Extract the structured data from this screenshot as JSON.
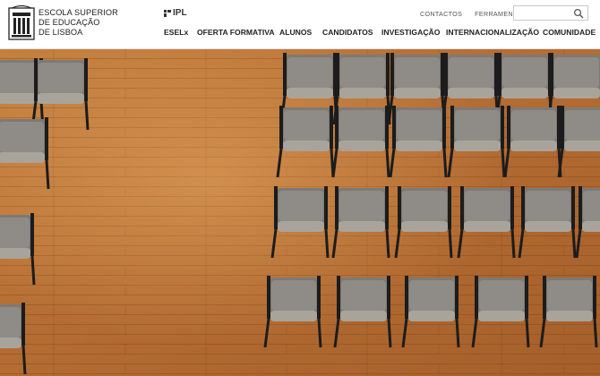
{
  "header": {
    "school_name_lines": [
      "ESCOLA SUPERIOR",
      "DE EDUCAÇÃO",
      "DE LISBOA"
    ],
    "partner_logo": "IPL",
    "utility_links": [
      "CONTACTOS",
      "FERRAMENTAS"
    ],
    "search": {
      "value": "",
      "placeholder": "",
      "icon": "search-icon"
    }
  },
  "nav": {
    "items": [
      "ESELx",
      "OFERTA FORMATIVA",
      "ALUNOS",
      "CANDIDATOS",
      "INVESTIGAÇÃO",
      "INTERNACIONALIZAÇÃO",
      "COMUNIDADE"
    ]
  },
  "hero": {
    "image": "auditorium seating rows on wooden floor, top-down view",
    "colors": {
      "floor": "#b9743a",
      "chair_frame": "#1c1c1c",
      "chair_seat": "#8d8a85",
      "chair_back": "#777470"
    }
  }
}
